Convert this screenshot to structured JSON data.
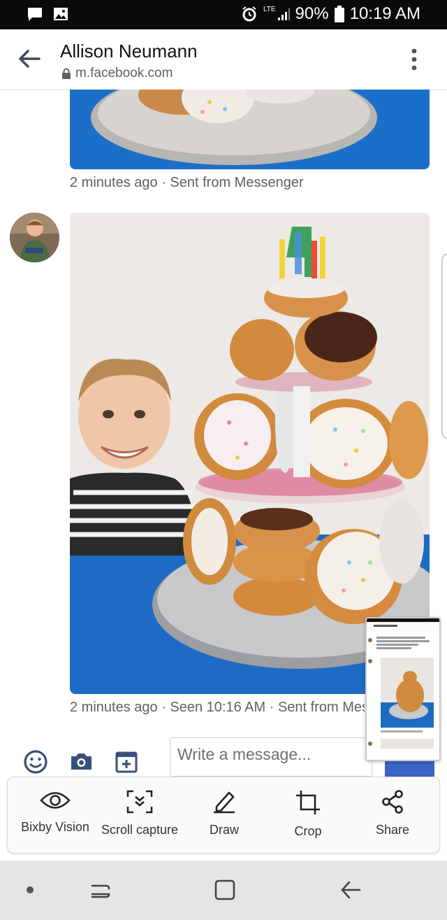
{
  "status_bar": {
    "network": "LTE",
    "battery": "90%",
    "time": "10:19 AM"
  },
  "header": {
    "title": "Allison Neumann",
    "url": "m.facebook.com"
  },
  "messages": [
    {
      "meta": "2 minutes ago · Sent from Messenger"
    },
    {
      "meta": "2 minutes ago · Seen 10:16 AM · Sent from Messenger"
    }
  ],
  "composer": {
    "placeholder": "Write a message..."
  },
  "toolbar": {
    "items": [
      {
        "label": "Bixby Vision",
        "icon": "eye-icon"
      },
      {
        "label": "Scroll capture",
        "icon": "scroll-capture-icon"
      },
      {
        "label": "Draw",
        "icon": "pencil-icon"
      },
      {
        "label": "Crop",
        "icon": "crop-icon"
      },
      {
        "label": "Share",
        "icon": "share-icon"
      }
    ]
  },
  "colors": {
    "facebook_blue": "#3b63c4",
    "table_blue": "#1b6fc8"
  }
}
